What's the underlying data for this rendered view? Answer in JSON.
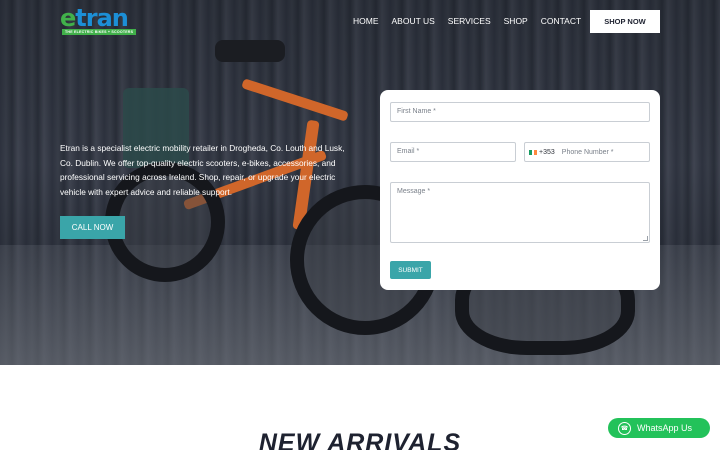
{
  "brand": {
    "logo_word": "tran",
    "logo_e": "e",
    "tagline": "THE ELECTRIC BIKES + SCOOTERS"
  },
  "nav": {
    "items": [
      {
        "label": "HOME"
      },
      {
        "label": "ABOUT US"
      },
      {
        "label": "SERVICES"
      },
      {
        "label": "SHOP"
      },
      {
        "label": "CONTACT"
      }
    ],
    "cta": "SHOP NOW"
  },
  "hero": {
    "intro": "Etran is a specialist electric mobility retailer in Drogheda, Co. Louth and Lusk, Co. Dublin. We offer top-quality electric scooters, e-bikes, accessories, and professional servicing across Ireland. Shop, repair, or upgrade your electric vehicle with expert advice and reliable support.",
    "call_label": "CALL NOW"
  },
  "form": {
    "first_name_placeholder": "First Name *",
    "email_placeholder": "Email *",
    "phone_dial_code": "+353",
    "phone_placeholder": "Phone Number *",
    "message_placeholder": "Message *",
    "submit_label": "SUBMIT",
    "flag_colors": [
      "#169b62",
      "#ffffff",
      "#ff883e"
    ]
  },
  "section": {
    "title": "NEW ARRIVALS"
  },
  "whatsapp": {
    "label": "WhatsApp Us",
    "icon": "whatsapp-icon"
  },
  "colors": {
    "accent": "#3aa5a9",
    "whatsapp": "#23c25a",
    "brand_blue": "#1c8fd6",
    "brand_green": "#41b04a"
  }
}
